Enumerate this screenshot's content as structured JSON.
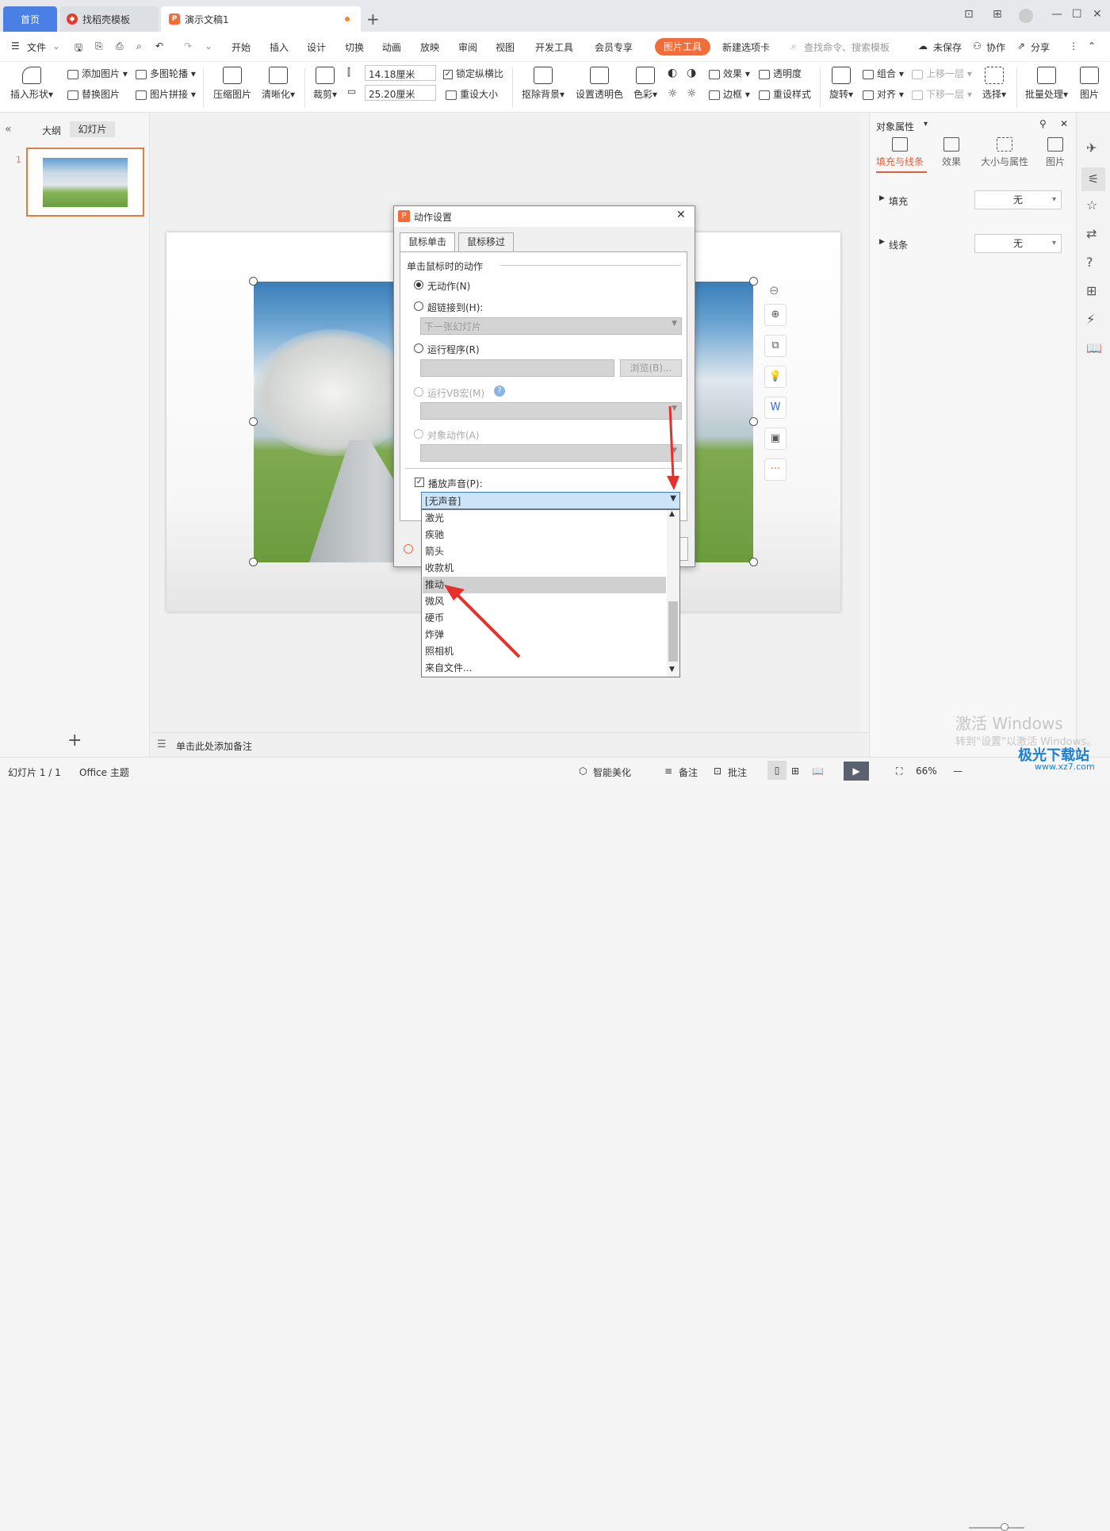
{
  "titlebar": {
    "tabs": [
      {
        "label": "首页"
      },
      {
        "label": "找稻壳模板"
      },
      {
        "label": "演示文稿1"
      }
    ],
    "plus": "+"
  },
  "menubar": {
    "file": "文件",
    "items": [
      "开始",
      "插入",
      "设计",
      "切换",
      "动画",
      "放映",
      "审阅",
      "视图",
      "开发工具",
      "会员专享"
    ],
    "pic_tool": "图片工具",
    "new_tab": "新建选项卡",
    "search_placeholder": "查找命令、搜索模板",
    "unsaved": "未保存",
    "collab": "协作",
    "share": "分享"
  },
  "ribbon": {
    "insert_shape": "插入形状",
    "add_picture": "添加图片",
    "multi_carousel": "多图轮播",
    "replace_picture": "替换图片",
    "picture_collage": "图片拼接",
    "compress": "压缩图片",
    "clarify": "清晰化",
    "crop": "裁剪",
    "height": "14.18厘米",
    "width": "25.20厘米",
    "lock_ratio": "锁定纵横比",
    "reset_size": "重设大小",
    "remove_bg": "抠除背景",
    "set_transparent": "设置透明色",
    "color": "色彩",
    "effect": "效果",
    "transparency": "透明度",
    "border": "边框",
    "reset_style": "重设样式",
    "rotate": "旋转",
    "group": "组合",
    "align": "对齐",
    "bring_forward": "上移一层",
    "send_backward": "下移一层",
    "select": "选择",
    "batch": "批量处理",
    "picture": "图片"
  },
  "leftpane": {
    "outline": "大纲",
    "slides": "幻灯片",
    "slide_number": "1",
    "add": "+"
  },
  "notes": {
    "placeholder": "单击此处添加备注"
  },
  "rightpane": {
    "title": "对象属性",
    "tabs": [
      "填充与线条",
      "效果",
      "大小与属性",
      "图片"
    ],
    "fill_label": "填充",
    "fill_value": "无",
    "line_label": "线条",
    "line_value": "无"
  },
  "dialog": {
    "title": "动作设置",
    "tabs": [
      "鼠标单击",
      "鼠标移过"
    ],
    "group_label": "单击鼠标时的动作",
    "no_action": "无动作(N)",
    "hyperlink": "超链接到(H):",
    "hyperlink_value": "下一张幻灯片",
    "run_program": "运行程序(R)",
    "browse": "浏览(B)...",
    "run_macro": "运行VB宏(M)",
    "object_action": "对象动作(A)",
    "play_sound": "播放声音(P):",
    "sound_value": "[无声音]"
  },
  "sound_list": {
    "items": [
      "激光",
      "疾驰",
      "箭头",
      "收款机",
      "推动",
      "微风",
      "硬币",
      "炸弹",
      "照相机",
      "来自文件..."
    ],
    "selected": "推动"
  },
  "statusbar": {
    "slide_info": "幻灯片 1 / 1",
    "theme": "Office 主题",
    "smart": "智能美化",
    "notes": "备注",
    "comment": "批注",
    "zoom": "66%"
  },
  "watermark": {
    "line1": "激活 Windows",
    "line2": "转到\"设置\"以激活 Windows。",
    "logo": "极光下载站",
    "logo_url": "www.xz7.com"
  },
  "colors": {
    "accent": "#f36d3a",
    "brand": "#4a7fe5",
    "selection": "#e07f3f",
    "arrow": "#e8302a"
  }
}
